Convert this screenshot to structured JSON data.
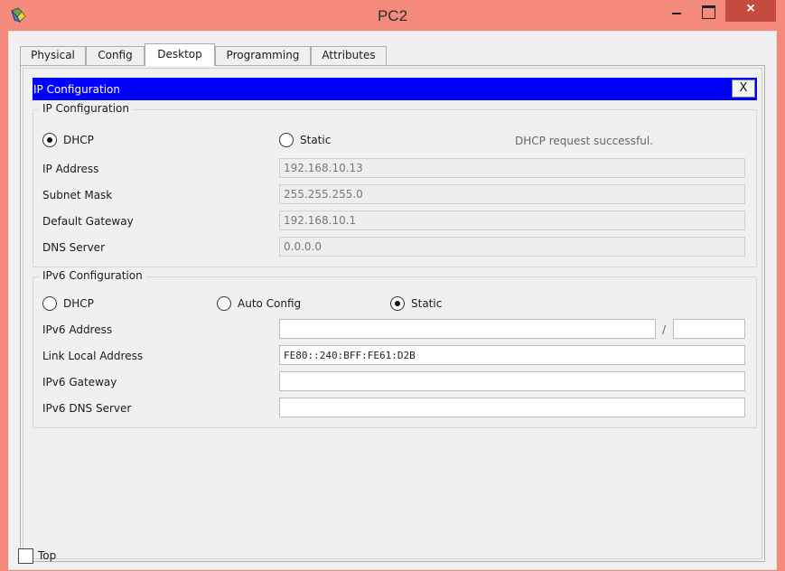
{
  "window": {
    "title": "PC2",
    "icon": "pc-device-icon",
    "controls": {
      "close_label": "×"
    }
  },
  "tabs": [
    {
      "label": "Physical",
      "active": false
    },
    {
      "label": "Config",
      "active": false
    },
    {
      "label": "Desktop",
      "active": true
    },
    {
      "label": "Programming",
      "active": false
    },
    {
      "label": "Attributes",
      "active": false
    }
  ],
  "ip_config": {
    "header_title": "IP Configuration",
    "close_label": "X",
    "ipv4": {
      "legend": "IP Configuration",
      "dhcp_label": "DHCP",
      "static_label": "Static",
      "selected": "DHCP",
      "status": "DHCP request successful.",
      "ip_label": "IP Address",
      "ip_value": "192.168.10.13",
      "mask_label": "Subnet Mask",
      "mask_value": "255.255.255.0",
      "gateway_label": "Default Gateway",
      "gateway_value": "192.168.10.1",
      "dns_label": "DNS Server",
      "dns_value": "0.0.0.0"
    },
    "ipv6": {
      "legend": "IPv6 Configuration",
      "dhcp_label": "DHCP",
      "auto_label": "Auto Config",
      "static_label": "Static",
      "selected": "Static",
      "address_label": "IPv6 Address",
      "address_value": "",
      "prefix_separator": "/",
      "prefix_value": "",
      "link_local_label": "Link Local Address",
      "link_local_value": "FE80::240:BFF:FE61:D2B",
      "gateway_label": "IPv6 Gateway",
      "gateway_value": "",
      "dns_label": "IPv6 DNS Server",
      "dns_value": ""
    }
  },
  "footer": {
    "top_label": "Top",
    "top_checked": false
  },
  "colors": {
    "window_frame": "#f48a7b",
    "close_button": "#c64a3e",
    "ip_header": "#0000ff"
  }
}
